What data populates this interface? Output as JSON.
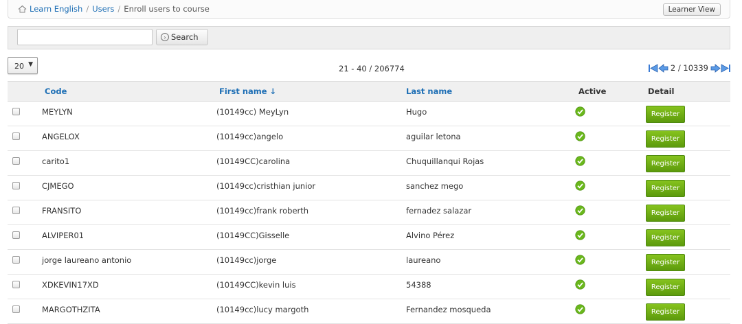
{
  "breadcrumb": {
    "home": "Learn English",
    "users": "Users",
    "current": "Enroll users to course",
    "separator": "/"
  },
  "learner_view_label": "Learner View",
  "search": {
    "value": "",
    "placeholder": "",
    "button_label": "Search"
  },
  "per_page": "20",
  "range_text": "21 - 40 / 206774",
  "pager_text": "2 / 10339",
  "columns": {
    "code": "Code",
    "first_name": "First name ↓",
    "last_name": "Last name",
    "active": "Active",
    "detail": "Detail"
  },
  "register_label": "Register",
  "colors": {
    "link": "#1e6fb5",
    "register_bg": "#6aab14",
    "active": "#6ab81c"
  },
  "rows": [
    {
      "code": "MEYLYN",
      "first": "(10149cc) MeyLyn",
      "last": "Hugo"
    },
    {
      "code": "ANGELOX",
      "first": "(10149cc)angelo",
      "last": "aguilar letona"
    },
    {
      "code": "carito1",
      "first": "(10149CC)carolina",
      "last": "Chuquillanqui Rojas"
    },
    {
      "code": "CJMEGO",
      "first": "(10149cc)cristhian junior",
      "last": "sanchez mego"
    },
    {
      "code": "FRANSITO",
      "first": "(10149cc)frank roberth",
      "last": "fernadez salazar"
    },
    {
      "code": "ALVIPER01",
      "first": "(10149CC)Gisselle",
      "last": "Alvino Pérez"
    },
    {
      "code": "jorge laureano antonio",
      "first": "(10149cc)jorge",
      "last": "laureano"
    },
    {
      "code": "XDKEVIN17XD",
      "first": "(10149CC)kevin luis",
      "last": "54388"
    },
    {
      "code": "MARGOTHZITA",
      "first": "(10149cc)lucy margoth",
      "last": "Fernandez mosqueda"
    }
  ]
}
